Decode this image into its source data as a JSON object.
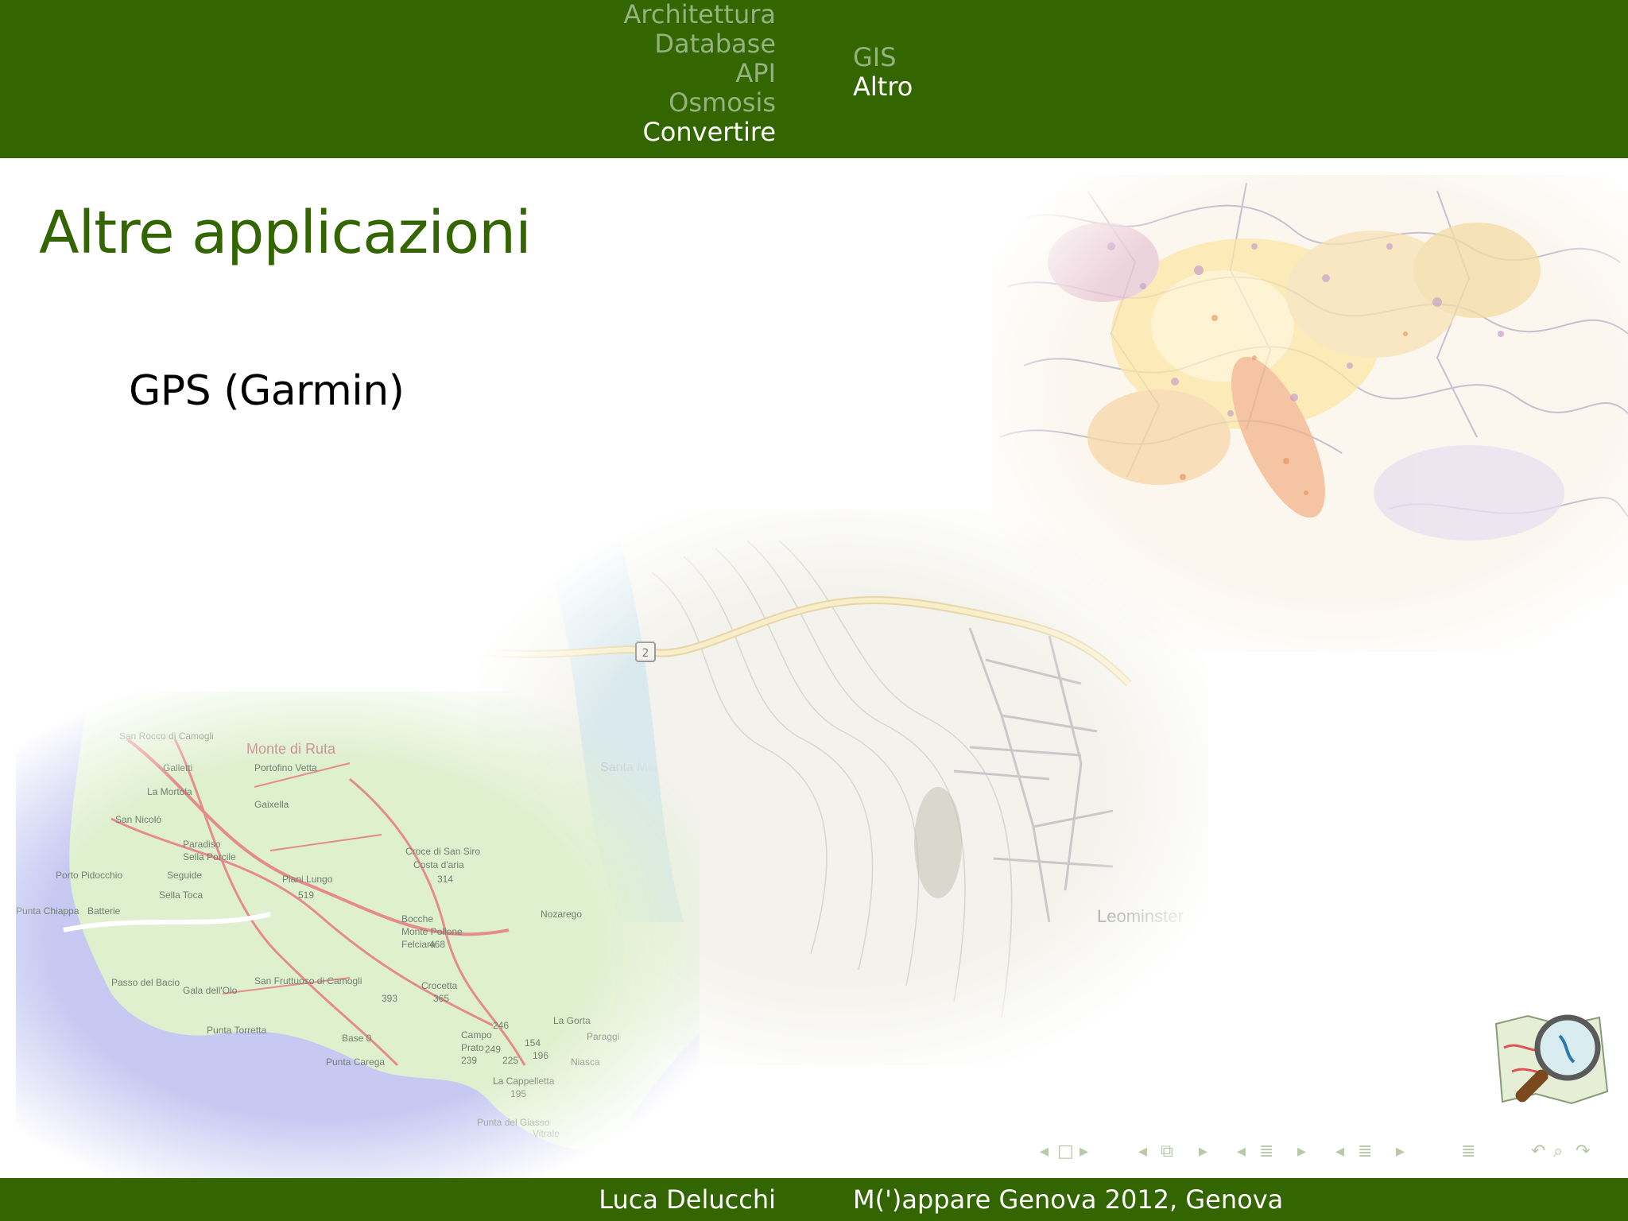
{
  "header": {
    "sections_left": [
      {
        "label": "Architettura",
        "active": false
      },
      {
        "label": "Database",
        "active": false
      },
      {
        "label": "API",
        "active": false
      },
      {
        "label": "Osmosis",
        "active": false
      },
      {
        "label": "Convertire",
        "active": true
      }
    ],
    "sections_right": [
      {
        "label": "GIS",
        "active": false
      },
      {
        "label": "Altro",
        "active": true
      }
    ]
  },
  "slide": {
    "title": "Altre applicazioni",
    "items": [
      "GPS (Garmin)"
    ]
  },
  "maps": {
    "coast_labels": [
      "San Rocco di Camogli",
      "Monte di Ruta",
      "Portofino Vetta",
      "Galletti",
      "La Mortola",
      "Gaixella",
      "San Nicolò",
      "Paradiso",
      "Sella Porcile",
      "Porto Pidocchio",
      "Seguide",
      "Piani Lungo",
      "Sella Toca",
      "519",
      "Croce di San Siro",
      "Costa d'aria",
      "314",
      "Punta Chiappa",
      "Batterie",
      "Bocche",
      "Monte Pollone",
      "Felciara",
      "468",
      "Nozarego",
      "Passo del Bacio",
      "Gala dell'Olo",
      "San Fruttuoso di Camogli",
      "393",
      "Crocetta",
      "365",
      "Punta Torretta",
      "Base 0",
      "246",
      "Campo",
      "Prato",
      "154",
      "249",
      "239",
      "225",
      "196",
      "Punta Carega",
      "La Cappelletta",
      "195",
      "Niasca",
      "Paraggi",
      "La Gorta",
      "Punta del Giasso",
      "Vitrale",
      "Santa Margherita Ligure"
    ],
    "city_labels": [
      "Leominster",
      "2"
    ]
  },
  "logo": {
    "icon": "openstreetmap-logo-icon"
  },
  "beamer_nav": {
    "symbols": [
      "◂",
      "□",
      "▸",
      "◂",
      "⧉",
      "▸",
      "◂",
      "≣",
      "▸",
      "◂",
      "≣",
      "▸",
      "≣",
      "↶",
      "⌕",
      "↷"
    ]
  },
  "footer": {
    "author": "Luca Delucchi",
    "event": "M(')appare Genova 2012, Genova"
  },
  "colors": {
    "theme_green": "#336600",
    "inactive_nav": "#96b37f",
    "active_nav": "#ffffff"
  }
}
